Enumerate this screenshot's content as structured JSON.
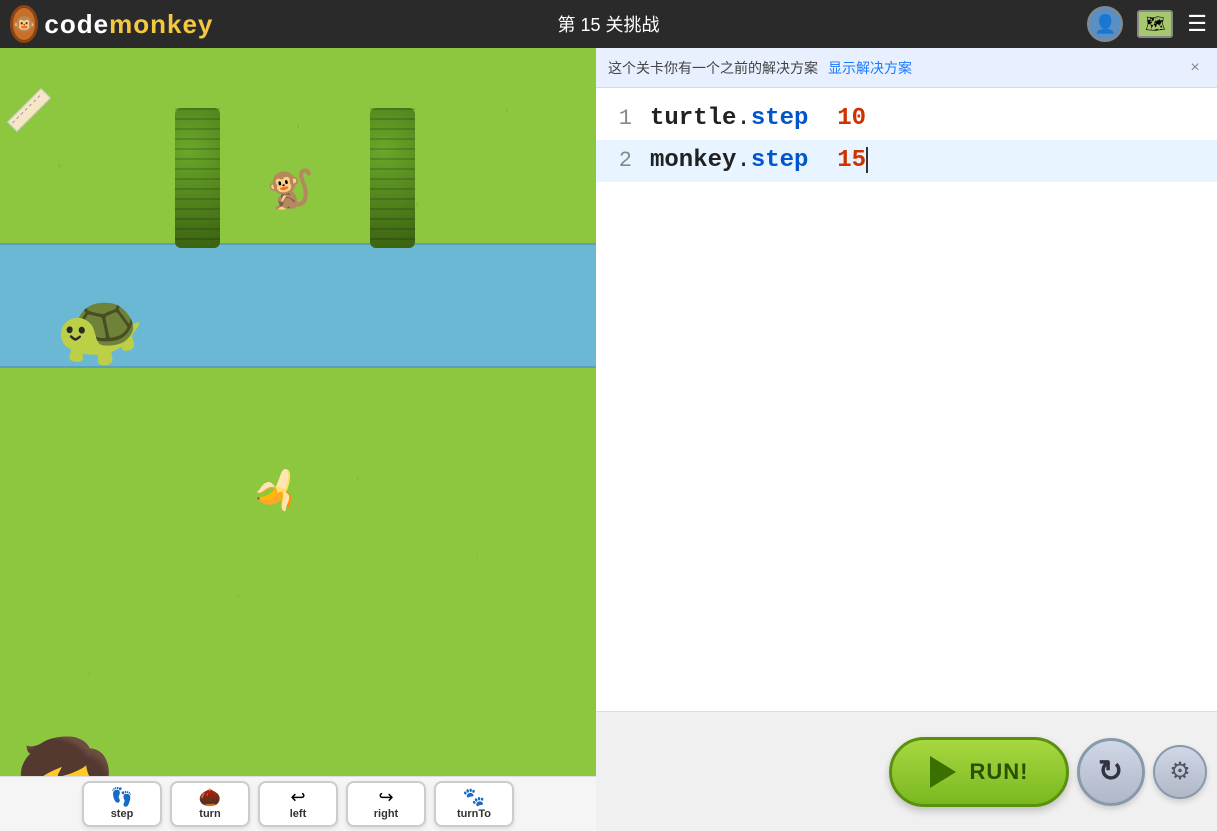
{
  "header": {
    "title": "第  15  关挑战",
    "logo_text": "CODEmonkey"
  },
  "notification": {
    "text": "这个关卡你有一个之前的解决方案",
    "link_text": "显示解决方案",
    "close_label": "×"
  },
  "code_editor": {
    "lines": [
      {
        "number": "1",
        "content": "turtle.step  10"
      },
      {
        "number": "2",
        "content": "monkey.step  15"
      }
    ]
  },
  "toolbar": {
    "run_label": "RUN!",
    "reset_label": "↺",
    "settings_label": "⚙"
  },
  "command_palette": {
    "buttons": [
      {
        "icon": "👣",
        "label": "step"
      },
      {
        "icon": "🌰",
        "label": "turn"
      },
      {
        "icon": "↩",
        "label": "left"
      },
      {
        "icon": "↪",
        "label": "right"
      },
      {
        "icon": "🐾",
        "label": "turnTo"
      }
    ]
  }
}
